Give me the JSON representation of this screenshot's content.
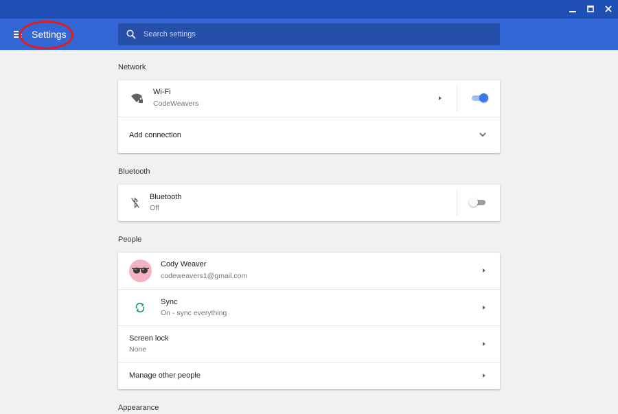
{
  "window": {
    "controls": [
      "minimize-icon",
      "maximize-icon",
      "close-icon"
    ],
    "titlebar_color": "#1e4fb4",
    "toolbar_color": "#3367d6"
  },
  "header": {
    "title": "Settings",
    "menu_icon": "hamburger-menu-icon",
    "search": {
      "placeholder": "Search settings",
      "value": ""
    }
  },
  "network": {
    "title": "Network",
    "wifi": {
      "label": "Wi-Fi",
      "subtitle": "CodeWeavers",
      "icon": "wifi-locked-icon",
      "enabled": true
    },
    "add_connection": {
      "label": "Add connection",
      "icon": "chevron-down-icon"
    }
  },
  "bluetooth": {
    "title": "Bluetooth",
    "item": {
      "label": "Bluetooth",
      "subtitle": "Off",
      "icon": "bluetooth-disabled-icon",
      "enabled": false
    }
  },
  "people": {
    "title": "People",
    "account": {
      "name": "Cody Weaver",
      "email": "codeweavers1@gmail.com",
      "icon": "avatar-sunglasses"
    },
    "sync": {
      "label": "Sync",
      "subtitle": "On - sync everything",
      "icon": "sync-icon",
      "color": "#0f9d58"
    },
    "screen_lock": {
      "label": "Screen lock",
      "subtitle": "None"
    },
    "manage": {
      "label": "Manage other people"
    }
  },
  "appearance": {
    "title": "Appearance"
  },
  "colors": {
    "accent": "#3b78e7",
    "annotation": "#e31c1c"
  }
}
